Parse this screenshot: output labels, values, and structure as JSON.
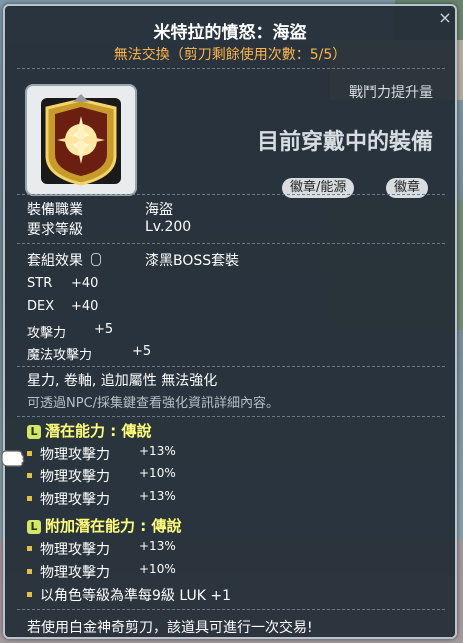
{
  "item": {
    "name": "米特拉的憤怒：海盜",
    "trade_status": "無法交換（剪刀剩餘使用次數：5/5）",
    "power_label": "戰鬥力提升量",
    "equipped_text": "目前穿戴中的裝備",
    "tags": [
      "徽章/能源",
      "徽章"
    ],
    "job_label": "裝備職業",
    "job_value": "海盜",
    "level_label": "要求等級",
    "level_value": "Lv.200",
    "set_label": "套組效果",
    "set_value": "漆黑BOSS套裝"
  },
  "stats": [
    {
      "name": "STR",
      "value": "+40"
    },
    {
      "name": "DEX",
      "value": "+40"
    },
    {
      "name": "攻擊力",
      "value": "+5"
    },
    {
      "name": "魔法攻擊力",
      "value": "+5"
    }
  ],
  "notes": {
    "enhance": "星力, 卷軸, 追加屬性 無法強化",
    "npc_hint": "可透過NPC/採集鍵查看強化資訊詳細內容。"
  },
  "potential": {
    "header_badge": "L",
    "header": "潛在能力 : 傳說",
    "lines": [
      {
        "name": "物理攻擊力",
        "value": "+13%"
      },
      {
        "name": "物理攻擊力",
        "value": "+10%"
      },
      {
        "name": "物理攻擊力",
        "value": "+13%"
      }
    ]
  },
  "additional_potential": {
    "header_badge": "L",
    "header": "附加潛在能力 : 傳說",
    "lines": [
      {
        "name": "物理攻擊力",
        "value": "+13%"
      },
      {
        "name": "物理攻擊力",
        "value": "+10%"
      },
      {
        "name": "以角色等級為準每9級 LUK +1",
        "value": ""
      }
    ]
  },
  "footer": "若使用白金神奇剪刀，該道具可進行一次交易!",
  "colors": {
    "title": "#ffffff",
    "trade_status": "#ffb54a",
    "section_header": "#ffff7a",
    "legend_badge": "#d3e86a"
  },
  "icons": [
    "emblem-icon",
    "close-icon",
    "mouse-icon",
    "potential-badge-icon",
    "pointer-glove-icon"
  ]
}
